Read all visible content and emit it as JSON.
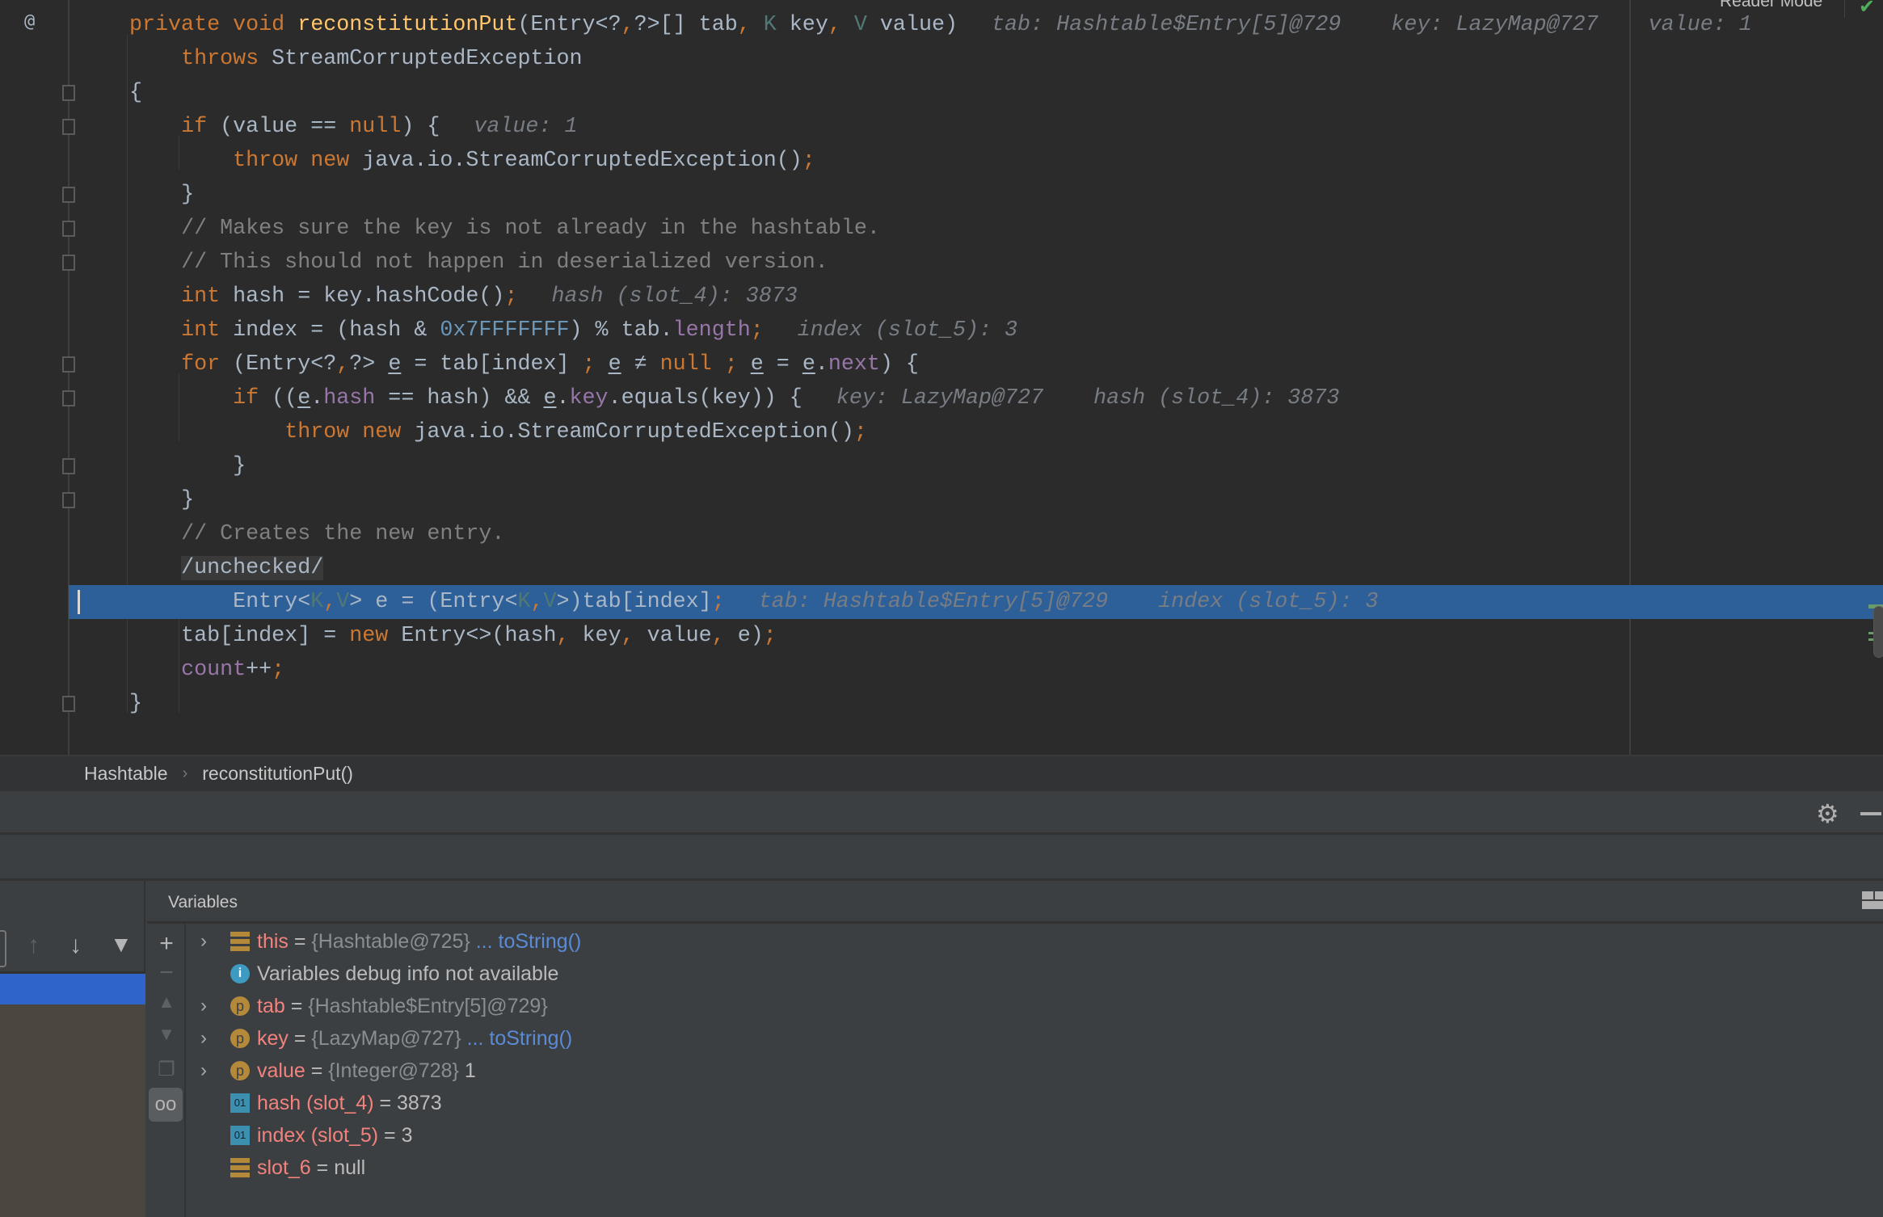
{
  "editor": {
    "reader_mode_label": "Reader Mode",
    "at_icon": "@",
    "current_line": 17,
    "lines": [
      {
        "indent": 0,
        "tokens": [
          [
            "private void ",
            "k"
          ],
          [
            "reconstitutionPut",
            "f"
          ],
          [
            "(Entry<?",
            "d"
          ],
          [
            ",",
            "k"
          ],
          [
            "?>[] tab",
            "d"
          ],
          [
            ", ",
            "k"
          ],
          [
            "K ",
            "t"
          ],
          [
            "key",
            "d"
          ],
          [
            ", ",
            "k"
          ],
          [
            "V ",
            "t"
          ],
          [
            "value)",
            "d"
          ]
        ],
        "hints": [
          "tab: Hashtable$Entry[5]@729",
          "key: LazyMap@727",
          "value: 1"
        ]
      },
      {
        "indent": 1,
        "tokens": [
          [
            "throws ",
            "k"
          ],
          [
            "StreamCorruptedException",
            "d"
          ]
        ],
        "hints": []
      },
      {
        "indent": 0,
        "tokens": [
          [
            "{",
            "d"
          ]
        ],
        "hints": []
      },
      {
        "indent": 1,
        "tokens": [
          [
            "if ",
            "k"
          ],
          [
            "(value == ",
            "d"
          ],
          [
            "null",
            "k"
          ],
          [
            ") {",
            "d"
          ]
        ],
        "hints": [
          "value: 1"
        ]
      },
      {
        "indent": 2,
        "tokens": [
          [
            "throw new ",
            "k"
          ],
          [
            "java.io.StreamCorruptedException()",
            "d"
          ],
          [
            ";",
            "k"
          ]
        ],
        "hints": []
      },
      {
        "indent": 1,
        "tokens": [
          [
            "}",
            "d"
          ]
        ],
        "hints": []
      },
      {
        "indent": 1,
        "tokens": [
          [
            "// Makes sure the key is not already in the hashtable.",
            "c"
          ]
        ],
        "hints": []
      },
      {
        "indent": 1,
        "tokens": [
          [
            "// This should not happen in deserialized version.",
            "c"
          ]
        ],
        "hints": []
      },
      {
        "indent": 1,
        "tokens": [
          [
            "int ",
            "k"
          ],
          [
            "hash = key.hashCode()",
            "d"
          ],
          [
            ";",
            "k"
          ]
        ],
        "hints": [
          "hash (slot_4): 3873"
        ]
      },
      {
        "indent": 1,
        "tokens": [
          [
            "int ",
            "k"
          ],
          [
            "index = (hash & ",
            "d"
          ],
          [
            "0x7FFFFFFF",
            "n"
          ],
          [
            ") % tab.",
            "d"
          ],
          [
            "length",
            "p"
          ],
          [
            ";",
            "k"
          ]
        ],
        "hints": [
          "index (slot_5): 3"
        ]
      },
      {
        "indent": 1,
        "tokens": [
          [
            "for ",
            "k"
          ],
          [
            "(Entry<?",
            "d"
          ],
          [
            ",",
            "k"
          ],
          [
            "?> ",
            "d"
          ],
          [
            "e",
            "u"
          ],
          [
            " = tab[index] ",
            "d"
          ],
          [
            "; ",
            "k"
          ],
          [
            "e",
            "u"
          ],
          [
            " ≠ ",
            "d"
          ],
          [
            "null ",
            "k"
          ],
          [
            "; ",
            "k"
          ],
          [
            "e",
            "u"
          ],
          [
            " = ",
            "d"
          ],
          [
            "e",
            "u"
          ],
          [
            ".",
            "d"
          ],
          [
            "next",
            "p"
          ],
          [
            ") {",
            "d"
          ]
        ],
        "hints": []
      },
      {
        "indent": 2,
        "tokens": [
          [
            "if ",
            "k"
          ],
          [
            "((",
            "d"
          ],
          [
            "e",
            "u"
          ],
          [
            ".",
            "d"
          ],
          [
            "hash",
            "p"
          ],
          [
            " == hash) && ",
            "d"
          ],
          [
            "e",
            "u"
          ],
          [
            ".",
            "d"
          ],
          [
            "key",
            "p"
          ],
          [
            ".equals(key)) {",
            "d"
          ]
        ],
        "hints": [
          "key: LazyMap@727",
          "hash (slot_4): 3873"
        ]
      },
      {
        "indent": 3,
        "tokens": [
          [
            "throw new ",
            "k"
          ],
          [
            "java.io.StreamCorruptedException()",
            "d"
          ],
          [
            ";",
            "k"
          ]
        ],
        "hints": []
      },
      {
        "indent": 2,
        "tokens": [
          [
            "}",
            "d"
          ]
        ],
        "hints": []
      },
      {
        "indent": 1,
        "tokens": [
          [
            "}",
            "d"
          ]
        ],
        "hints": []
      },
      {
        "indent": 1,
        "tokens": [
          [
            "// Creates the new entry.",
            "c"
          ]
        ],
        "hints": []
      },
      {
        "indent": 1,
        "tokens": [
          [
            "/unchecked/",
            "ann"
          ]
        ],
        "hints": []
      },
      {
        "indent": 2,
        "tokens": [
          [
            "Entry<",
            "d"
          ],
          [
            "K",
            "t"
          ],
          [
            ",",
            "k"
          ],
          [
            "V",
            "t"
          ],
          [
            "> e = (Entry<",
            "d"
          ],
          [
            "K",
            "t"
          ],
          [
            ",",
            "k"
          ],
          [
            "V",
            "t"
          ],
          [
            ">)tab[index]",
            "d"
          ],
          [
            ";",
            "k"
          ]
        ],
        "hints": [
          "tab: Hashtable$Entry[5]@729",
          "index (slot_5): 3"
        ]
      },
      {
        "indent": 1,
        "tokens": [
          [
            "tab[index] = ",
            "d"
          ],
          [
            "new ",
            "k"
          ],
          [
            "Entry<>(hash",
            "d"
          ],
          [
            ", ",
            "k"
          ],
          [
            "key",
            "d"
          ],
          [
            ", ",
            "k"
          ],
          [
            "value",
            "d"
          ],
          [
            ", ",
            "k"
          ],
          [
            "e)",
            "d"
          ],
          [
            ";",
            "k"
          ]
        ],
        "hints": []
      },
      {
        "indent": 1,
        "tokens": [
          [
            "count",
            "p"
          ],
          [
            "++",
            "d"
          ],
          [
            ";",
            "k"
          ]
        ],
        "hints": []
      },
      {
        "indent": 0,
        "tokens": [
          [
            "}",
            "d"
          ]
        ],
        "hints": []
      }
    ],
    "fold_lines": [
      2,
      3,
      5,
      6,
      7,
      10,
      11,
      13,
      14,
      20
    ]
  },
  "breadcrumb": {
    "items": [
      "Hashtable",
      "reconstitutionPut()"
    ],
    "separator": "›"
  },
  "debugger": {
    "variables_title": "Variables",
    "variables": [
      {
        "expandable": true,
        "icon": "field-icon",
        "name": "this",
        "eq": " = ",
        "value": "{Hashtable@725}",
        "link": " ... toString()"
      },
      {
        "expandable": false,
        "icon": "info-icon",
        "name": "",
        "eq": "",
        "value": "",
        "message": "Variables debug info not available"
      },
      {
        "expandable": true,
        "icon": "parameter-icon",
        "name": "tab",
        "eq": " = ",
        "value": "{Hashtable$Entry[5]@729}"
      },
      {
        "expandable": true,
        "icon": "parameter-icon",
        "name": "key",
        "eq": " = ",
        "value": "{LazyMap@727}",
        "link": " ... toString()"
      },
      {
        "expandable": true,
        "icon": "parameter-icon",
        "name": "value",
        "eq": " = ",
        "value": "{Integer@728}",
        "plain": " 1"
      },
      {
        "expandable": false,
        "icon": "primitive-icon",
        "name": "hash (slot_4)",
        "eq": " = ",
        "plain": "3873"
      },
      {
        "expandable": false,
        "icon": "primitive-icon",
        "name": "index (slot_5)",
        "eq": " = ",
        "plain": "3"
      },
      {
        "expandable": false,
        "icon": "field-icon",
        "name": "slot_6",
        "eq": " = ",
        "plain": "null"
      }
    ]
  },
  "colors": {
    "keyword": "#cc7832",
    "function": "#ffc66d",
    "text": "#a9b7c6",
    "comment": "#808080",
    "number": "#6897bb",
    "field": "#9876aa",
    "current_line": "#2d5f99",
    "var_name": "#f2827d",
    "link": "#5a8bd6"
  }
}
